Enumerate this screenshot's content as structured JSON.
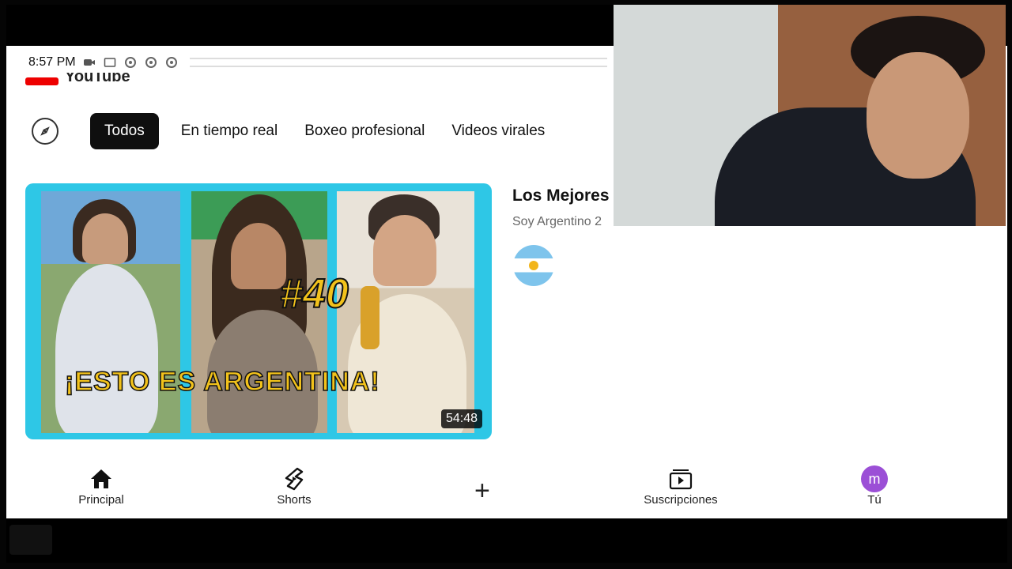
{
  "status_bar": {
    "time": "8:57 PM",
    "icons": [
      "video-call-icon",
      "screen-icon",
      "notification-icon",
      "notification-icon",
      "notification-icon"
    ]
  },
  "logo": {
    "text": "YouTube"
  },
  "chips": [
    {
      "label": "Todos",
      "active": true
    },
    {
      "label": "En tiempo real",
      "active": false
    },
    {
      "label": "Boxeo profesional",
      "active": false
    },
    {
      "label": "Videos virales",
      "active": false
    }
  ],
  "video": {
    "thumbnail_number": "#40",
    "thumbnail_title": "¡ESTO ES ARGENTINA!",
    "duration": "54:48",
    "title": "Los Mejores",
    "channel": "Soy Argentino 2"
  },
  "bottom_nav": {
    "home": "Principal",
    "shorts": "Shorts",
    "create": "+",
    "subscriptions": "Suscripciones",
    "you": "Tú",
    "you_initial": "m"
  },
  "colors": {
    "accent_red": "#e00000",
    "thumbnail_border": "#2ec7e6",
    "thumbnail_text": "#f2c21b",
    "avatar_purple": "#9b4fd6"
  }
}
